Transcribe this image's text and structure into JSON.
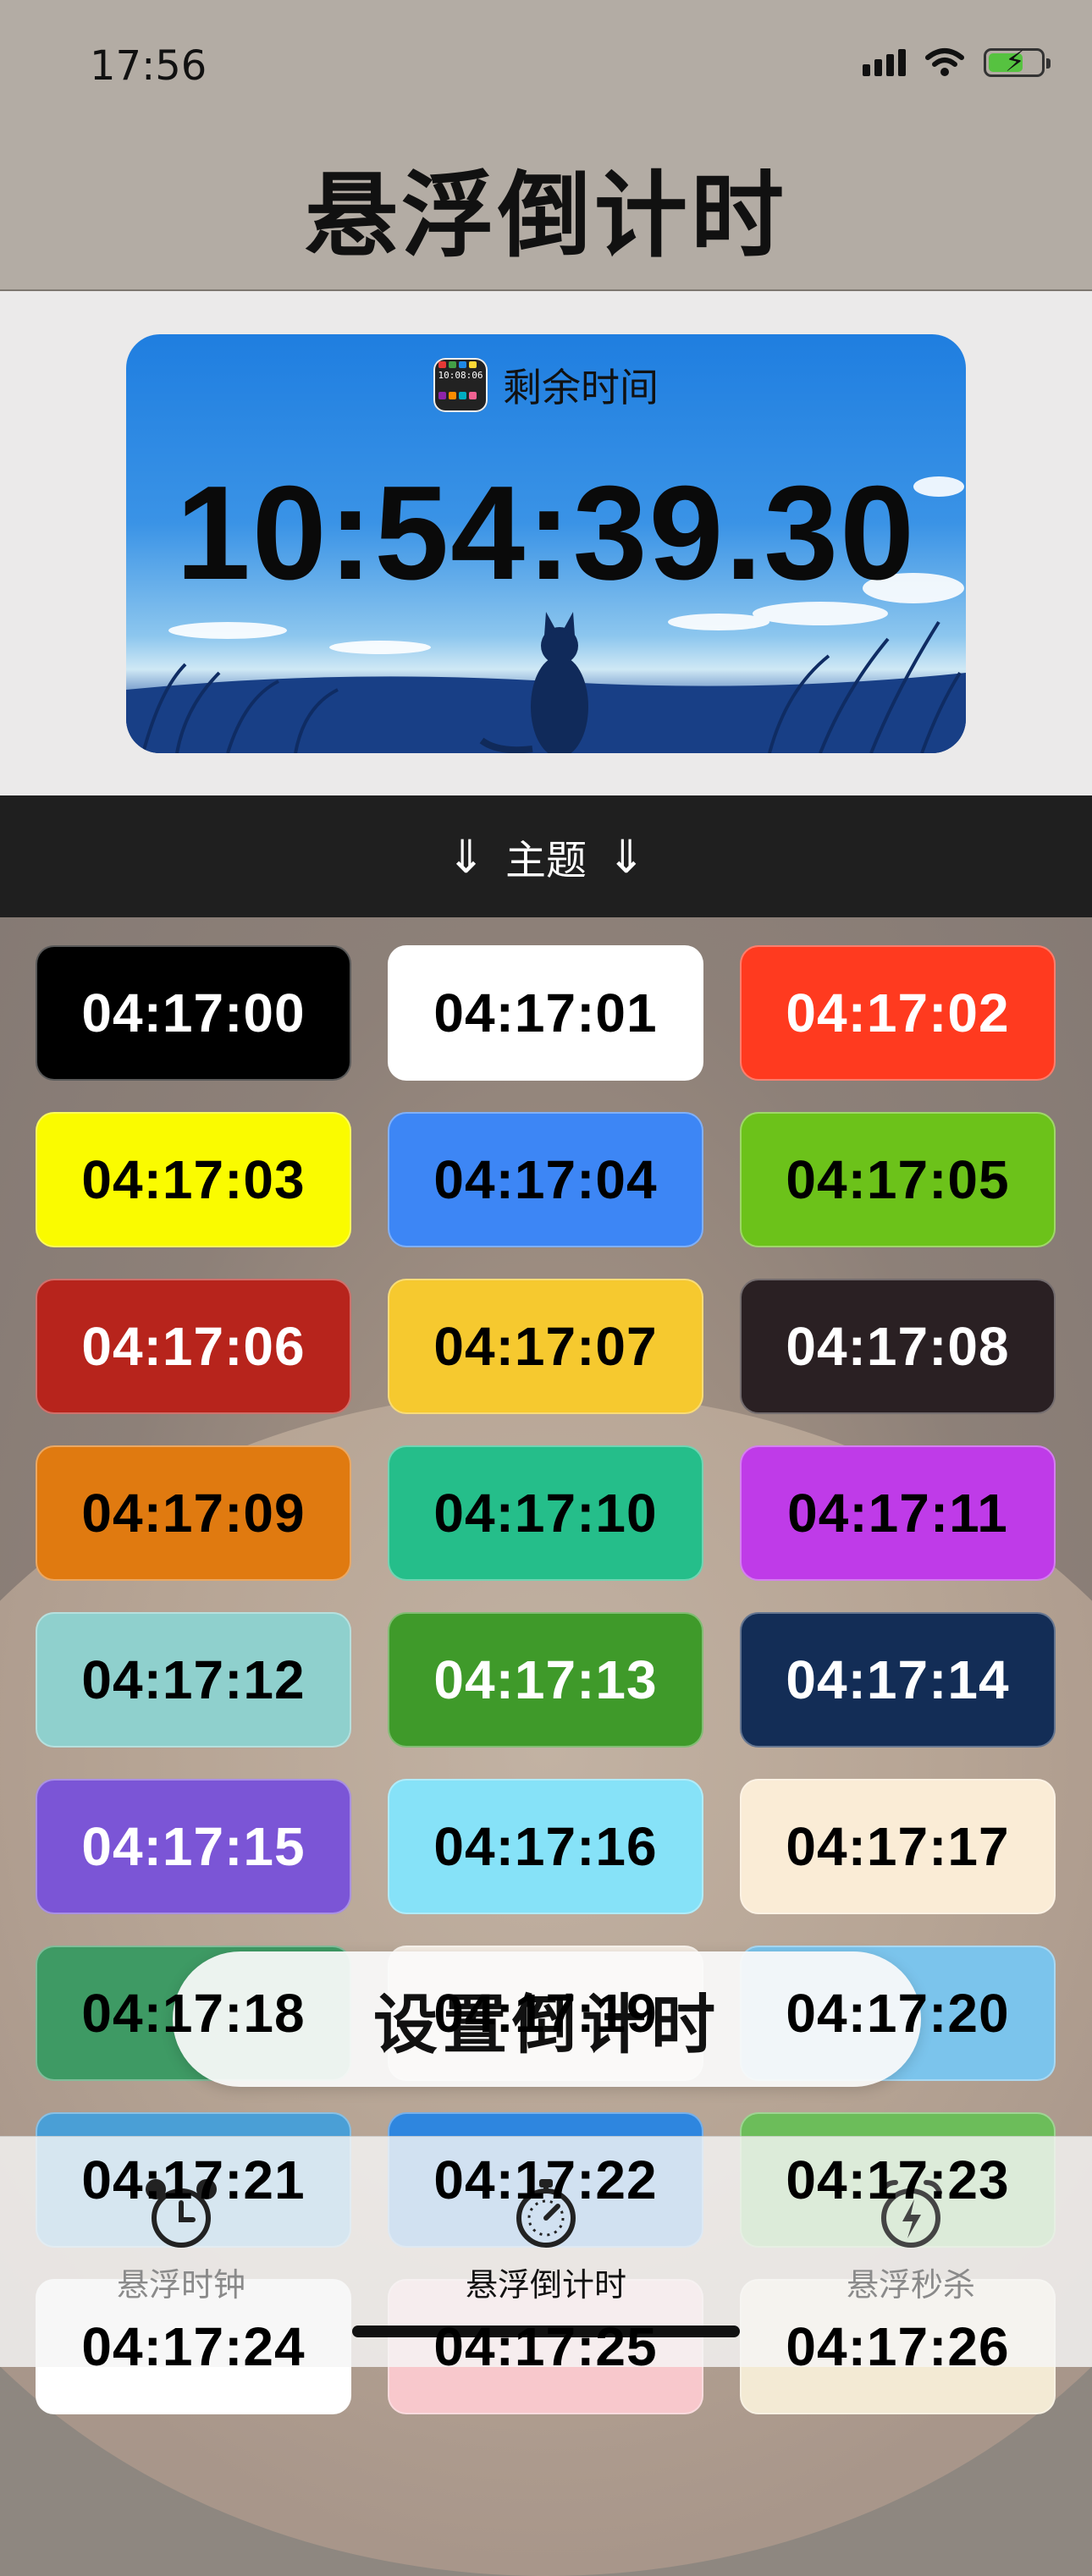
{
  "status_bar": {
    "time": "17:56"
  },
  "header": {
    "title": "悬浮倒计时"
  },
  "hero": {
    "label": "剩余时间",
    "time": "10:54:39.30",
    "app_icon_text": "10:08:06"
  },
  "theme_bar": {
    "arrow_left": "⇓",
    "label": "主题",
    "arrow_right": "⇓"
  },
  "themes": [
    {
      "time": "04:17:00",
      "bg": "#000000",
      "fg": "#ffffff"
    },
    {
      "time": "04:17:01",
      "bg": "#ffffff",
      "fg": "#000000"
    },
    {
      "time": "04:17:02",
      "bg": "#ff3a1f",
      "fg": "#ffffff"
    },
    {
      "time": "04:17:03",
      "bg": "#fafb00",
      "fg": "#000000"
    },
    {
      "time": "04:17:04",
      "bg": "#3d86f5",
      "fg": "#000000"
    },
    {
      "time": "04:17:05",
      "bg": "#6cc21a",
      "fg": "#000000"
    },
    {
      "time": "04:17:06",
      "bg": "#b7241c",
      "fg": "#ffffff"
    },
    {
      "time": "04:17:07",
      "bg": "#f6c92f",
      "fg": "#000000"
    },
    {
      "time": "04:17:08",
      "bg": "#2a2023",
      "fg": "#ffffff"
    },
    {
      "time": "04:17:09",
      "bg": "#e07a10",
      "fg": "#000000"
    },
    {
      "time": "04:17:10",
      "bg": "#25be8a",
      "fg": "#000000"
    },
    {
      "time": "04:17:11",
      "bg": "#bf3be8",
      "fg": "#000000"
    },
    {
      "time": "04:17:12",
      "bg": "#8fd0cd",
      "fg": "#000000"
    },
    {
      "time": "04:17:13",
      "bg": "#3f9a2a",
      "fg": "#ffffff"
    },
    {
      "time": "04:17:14",
      "bg": "#132d56",
      "fg": "#ffffff"
    },
    {
      "time": "04:17:15",
      "bg": "#7b55d6",
      "fg": "#ffffff"
    },
    {
      "time": "04:17:16",
      "bg": "#86e2f8",
      "fg": "#000000"
    },
    {
      "time": "04:17:17",
      "bg": "#faecd6",
      "fg": "#000000"
    },
    {
      "time": "04:17:18",
      "bg": "#3e9a64",
      "fg": "#000000"
    },
    {
      "time": "04:17:19",
      "bg": "#f5ede4",
      "fg": "#000000"
    },
    {
      "time": "04:17:20",
      "bg": "#7bc4ec",
      "fg": "#000000"
    },
    {
      "time": "04:17:21",
      "bg": "#4a9fd6",
      "fg": "#000000"
    },
    {
      "time": "04:17:22",
      "bg": "#2e86df",
      "fg": "#000000"
    },
    {
      "time": "04:17:23",
      "bg": "#6cbd5a",
      "fg": "#000000"
    },
    {
      "time": "04:17:24",
      "bg": "#ffffff",
      "fg": "#000000"
    },
    {
      "time": "04:17:25",
      "bg": "#f8c8cc",
      "fg": "#000000"
    },
    {
      "time": "04:17:26",
      "bg": "#f3ead4",
      "fg": "#000000"
    }
  ],
  "set_button": {
    "label": "设置倒计时"
  },
  "tabs": [
    {
      "label": "悬浮时钟",
      "icon": "alarm-clock-icon",
      "active": false
    },
    {
      "label": "悬浮倒计时",
      "icon": "stopwatch-icon",
      "active": true
    },
    {
      "label": "悬浮秒杀",
      "icon": "flash-alarm-icon",
      "active": false
    }
  ],
  "colors": {
    "header_bg": "#b3aca4",
    "hero_blue": "#1f7ee0",
    "theme_bar_bg": "#1f1f1f",
    "tab_active": "#111111",
    "tab_inactive": "#8a8a8a"
  }
}
